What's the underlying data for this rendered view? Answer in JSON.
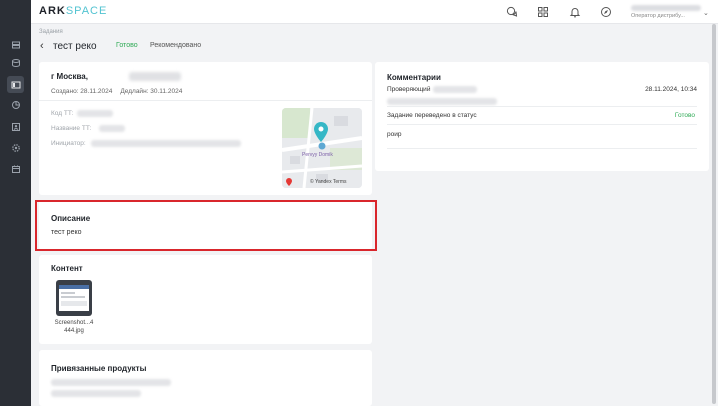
{
  "header": {
    "logo_main": "ARK",
    "logo_accent": "SPACE",
    "user_role": "Оператор дистрибу..."
  },
  "page": {
    "breadcrumb": "Задания",
    "title": "тест реко",
    "status_done": "Готово",
    "status_rec": "Рекомендовано"
  },
  "info": {
    "address": "г Москва,",
    "created": "Создано: 28.11.2024",
    "deadline": "Дедлайн: 30.11.2024",
    "fields": {
      "code_label": "Код ТТ:",
      "name_label": "Название ТТ:",
      "initiator_label": "Инициатор:"
    },
    "map": {
      "place": "Pervyy Domik",
      "attribution": "© Yandex Terms"
    }
  },
  "description": {
    "title": "Описание",
    "text": "тест реко"
  },
  "content": {
    "title": "Контент",
    "file_name_line1": "Screenshot...4",
    "file_name_line2": "444.jpg"
  },
  "products": {
    "title": "Привязанные продукты"
  },
  "comments": {
    "title": "Комментарии",
    "author_label": "Проверяющий",
    "date": "28.11.2024, 10:34",
    "status_text": "Задание переведено в статус",
    "status_value": "Готово",
    "message": "роир"
  },
  "colors": {
    "sidebar_bg": "#2b2f36",
    "accent_green": "#2eaa55",
    "highlight_red": "#d9262c",
    "logo_accent": "#52c3d1"
  },
  "icons": {
    "sidebar": [
      "layers-icon",
      "database-icon",
      "tasks-icon",
      "chart-icon",
      "people-icon",
      "settings-icon",
      "calendar-icon"
    ],
    "topbar": [
      "chat-icon",
      "grid-icon",
      "bell-icon",
      "compass-icon"
    ]
  }
}
